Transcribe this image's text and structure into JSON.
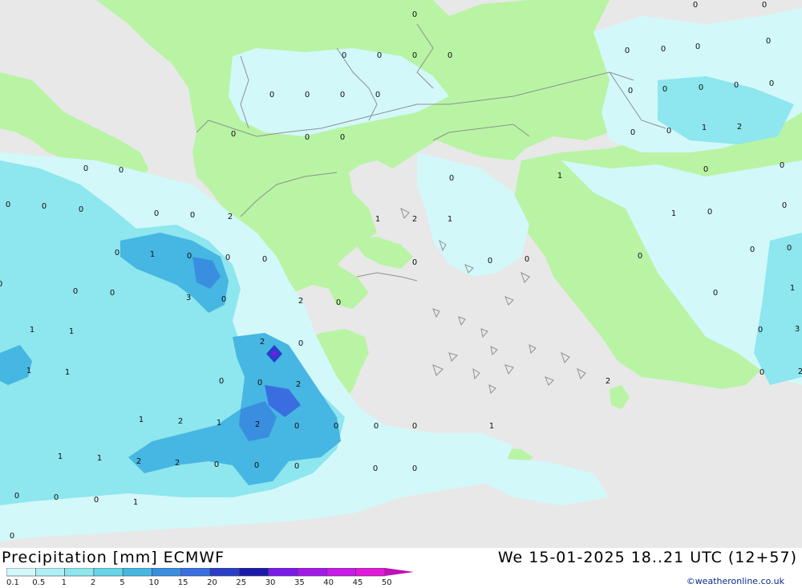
{
  "header": {
    "title": "Precipitation [mm] ECMWF",
    "datetime": "We 15-01-2025 18..21 UTC (12+57)",
    "credit": "©weatheronline.co.uk"
  },
  "legend": {
    "levels": [
      "0.1",
      "0.5",
      "1",
      "2",
      "5",
      "10",
      "15",
      "20",
      "25",
      "30",
      "35",
      "40",
      "45",
      "50"
    ],
    "colors": [
      "#d2f8fa",
      "#aef0f5",
      "#8ee6ee",
      "#66d4e8",
      "#46b6e2",
      "#3a8ee0",
      "#3a6ee0",
      "#2a3ec8",
      "#1a1aa8",
      "#7a1ae8",
      "#a21ae8",
      "#c81ae8",
      "#e01ad8",
      "#c010b8"
    ]
  },
  "map": {
    "colors": {
      "sea": "#e8e8e8",
      "land": "#b8f4a4",
      "precip_light": "#d2f8fa",
      "precip_mid": "#8ee6ee",
      "precip_heavy": "#46b6e2",
      "precip_max": "#2a3ec8",
      "border": "#909090"
    },
    "labels": [
      "0",
      "0",
      "0",
      "0",
      "0",
      "0",
      "0",
      "0",
      "0",
      "0",
      "0",
      "0",
      "0",
      "0",
      "0",
      "0",
      "0",
      "1",
      "2",
      "0",
      "0",
      "0",
      "0",
      "0",
      "0",
      "0",
      "0",
      "0",
      "0",
      "0",
      "1",
      "1",
      "0",
      "0",
      "0",
      "0",
      "0",
      "0",
      "0",
      "0",
      "0",
      "0",
      "0",
      "2",
      "1",
      "2",
      "1",
      "0",
      "1",
      "0",
      "0",
      "0",
      "0",
      "0",
      "0",
      "0",
      "0",
      "1",
      "0",
      "0",
      "3",
      "0",
      "2",
      "0",
      "1",
      "1",
      "1",
      "1",
      "2",
      "0",
      "0",
      "0",
      "2",
      "2",
      "0",
      "3",
      "0",
      "2",
      "1",
      "2",
      "1",
      "2",
      "0",
      "0",
      "0",
      "0",
      "1",
      "1",
      "1",
      "2",
      "2",
      "0",
      "0",
      "0",
      "0",
      "0",
      "0",
      "0",
      "0",
      "1",
      "0",
      "0"
    ]
  }
}
